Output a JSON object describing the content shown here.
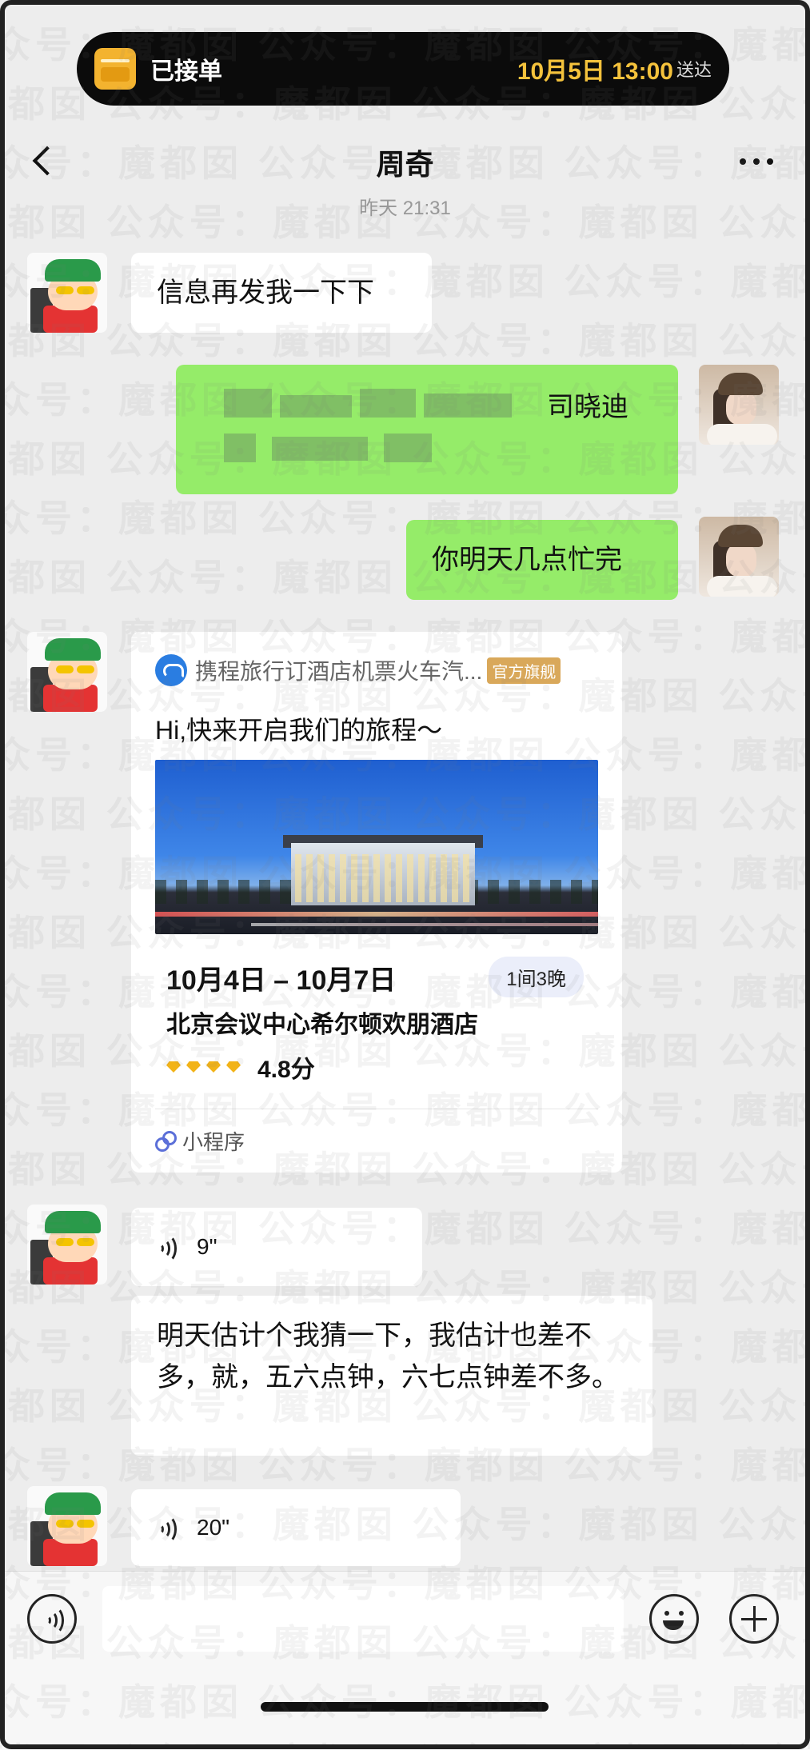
{
  "order_banner": {
    "status": "已接单",
    "time": "10月5日 13:00",
    "send_label": "送达"
  },
  "header": {
    "title": "周奇",
    "timestamp_hint": "昨天 21:31"
  },
  "messages": [
    {
      "side": "left",
      "type": "text",
      "text": "信息再发我一下下"
    },
    {
      "side": "right",
      "type": "text_blurred",
      "visible_text": "司晓迪"
    },
    {
      "side": "right",
      "type": "text",
      "text": "你明天几点忙完"
    },
    {
      "side": "left",
      "type": "mini_program",
      "source": "携程旅行订酒店机票火车汽...",
      "source_tag": "官方旗舰",
      "title": "Hi,快来开启我们的旅程～",
      "dates": "10月4日 – 10月7日",
      "nights": "1间3晚",
      "hotel_name": "北京会议中心希尔顿欢朋酒店",
      "rating": "4.8分",
      "diamond_count": 4,
      "footer": "小程序"
    },
    {
      "side": "left",
      "type": "voice",
      "duration": "9\""
    },
    {
      "side": "left",
      "type": "transcript",
      "text": "明天估计个我猜一下，我估计也差不多，就，五六点钟，六七点钟差不多。"
    },
    {
      "side": "left",
      "type": "voice",
      "duration": "20\""
    }
  ],
  "watermark": "公众号：魔都囡",
  "icons": {
    "back": "chevron-left-icon",
    "more": "more-dots-icon",
    "voice_input": "voice-input-icon",
    "emoji": "emoji-icon",
    "add": "plus-icon"
  },
  "colors": {
    "background": "#ededed",
    "bubble_green": "#95ec69",
    "bubble_white": "#ffffff",
    "order_time": "#f4c23c",
    "official_tag": "#d9a85a"
  }
}
